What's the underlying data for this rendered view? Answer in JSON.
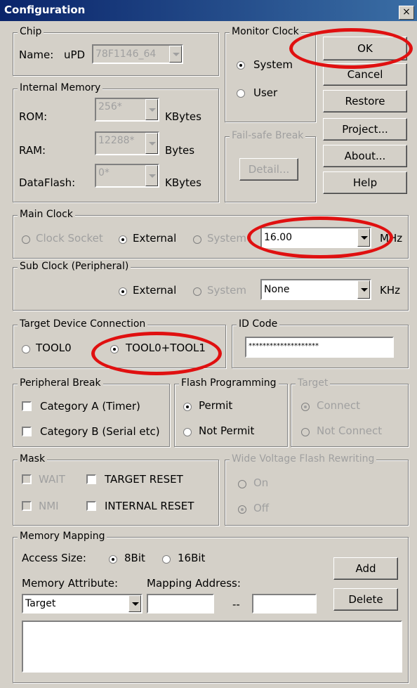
{
  "window": {
    "title": "Configuration",
    "close_glyph": "×"
  },
  "buttons": {
    "ok": "OK",
    "cancel": "Cancel",
    "restore": "Restore",
    "project": "Project...",
    "about": "About...",
    "help": "Help"
  },
  "chip": {
    "legend": "Chip",
    "name_label": "Name:",
    "name_prefix": "uPD",
    "name_value": "78F1146_64"
  },
  "monitor_clock": {
    "legend": "Monitor Clock",
    "system": "System",
    "user": "User",
    "selected": "System"
  },
  "internal_memory": {
    "legend": "Internal Memory",
    "rom_label": "ROM:",
    "rom_value": "256*",
    "rom_unit": "KBytes",
    "ram_label": "RAM:",
    "ram_value": "12288*",
    "ram_unit": "Bytes",
    "dataflash_label": "DataFlash:",
    "dataflash_value": "0*",
    "dataflash_unit": "KBytes"
  },
  "fail_safe": {
    "legend": "Fail-safe Break",
    "detail": "Detail..."
  },
  "main_clock": {
    "legend": "Main Clock",
    "clock_socket": "Clock Socket",
    "external": "External",
    "system": "System",
    "value": "16.00",
    "unit": "MHz",
    "selected": "External"
  },
  "sub_clock": {
    "legend": "Sub Clock (Peripheral)",
    "external": "External",
    "system": "System",
    "value": "None",
    "unit": "KHz",
    "selected": "External"
  },
  "target_conn": {
    "legend": "Target Device Connection",
    "tool0": "TOOL0",
    "tool01": "TOOL0+TOOL1",
    "selected": "TOOL0+TOOL1"
  },
  "id_code": {
    "legend": "ID Code",
    "value": "********************"
  },
  "peripheral_break": {
    "legend": "Peripheral Break",
    "cat_a": "Category A (Timer)",
    "cat_b": "Category B (Serial etc)"
  },
  "flash_prog": {
    "legend": "Flash Programming",
    "permit": "Permit",
    "not_permit": "Not Permit",
    "selected": "Permit"
  },
  "target": {
    "legend": "Target",
    "connect": "Connect",
    "not_connect": "Not Connect",
    "selected": "Connect"
  },
  "mask": {
    "legend": "Mask",
    "wait": "WAIT",
    "target_reset": "TARGET RESET",
    "nmi": "NMI",
    "internal_reset": "INTERNAL RESET"
  },
  "wide_voltage": {
    "legend": "Wide Voltage Flash Rewriting",
    "on": "On",
    "off": "Off",
    "selected": "Off"
  },
  "memory_mapping": {
    "legend": "Memory Mapping",
    "access_size_label": "Access Size:",
    "bit8": "8Bit",
    "bit16": "16Bit",
    "selected": "8Bit",
    "attr_label": "Memory Attribute:",
    "addr_label": "Mapping Address:",
    "attr_value": "Target",
    "range_sep": "--",
    "add": "Add",
    "delete": "Delete"
  },
  "annotations": {
    "color": "#e01010"
  }
}
